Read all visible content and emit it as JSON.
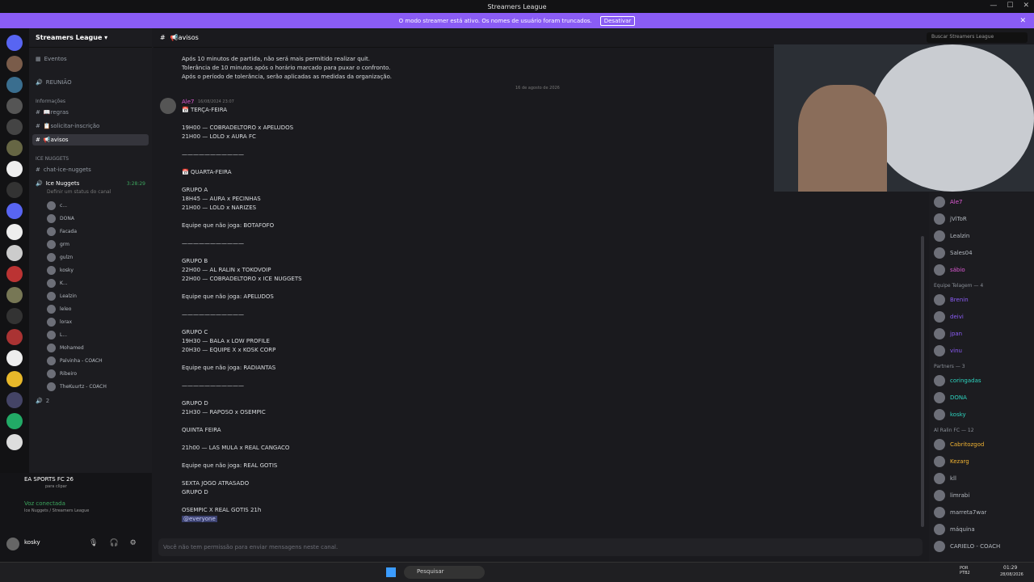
{
  "window": {
    "title": "Streamers League"
  },
  "banner": {
    "text": "O modo streamer está ativo. Os nomes de usuário foram truncados.",
    "button": "Desativar"
  },
  "server": {
    "name": "Streamers League"
  },
  "sidebar": {
    "events": "Eventos",
    "meeting": "REUNIÃO",
    "category_info": "Informações",
    "channels": [
      {
        "name": "📖regras"
      },
      {
        "name": "📋solicitar-inscrição"
      },
      {
        "name": "📢avisos"
      }
    ],
    "category_ice": "ICE NUGGETS",
    "chat_channel": "chat-ice-nuggets",
    "voice": {
      "name": "Ice Nuggets",
      "timer": "3:28:29",
      "status": "Definir um status do canal"
    },
    "voice_users": [
      "c...",
      "DONA",
      "Facada",
      "grm",
      "gulzn",
      "kosky",
      "K...",
      "Lealzin",
      "leleo",
      "lorax",
      "L...",
      "Mohamed",
      "Palvinha - COACH",
      "Ribeiro",
      "TheKuurtz - COACH"
    ],
    "more": "2"
  },
  "activity": {
    "game": "EA SPORTS FC 26",
    "hint": "para clipar",
    "voice_label": "Voz conectada",
    "voice_path": "Ice Nuggets / Streamers League"
  },
  "user": {
    "name": "kosky",
    "status": "..."
  },
  "channel": {
    "name": "📢avisos"
  },
  "search": {
    "placeholder": "Buscar Streamers League"
  },
  "messages": {
    "top_lines": [
      "Após 10 minutos de partida, não será mais permitido realizar quit.",
      "Tolerância de 10 minutos após o horário marcado para puxar o confronto.",
      "Após o período de tolerância, serão aplicadas as medidas da organização."
    ],
    "date_divider": "16 de agosto de 2026",
    "author": "Ale7",
    "timestamp": "16/08/2024 23:07",
    "lines": [
      "📅 TERÇA-FEIRA",
      "",
      "19H00 — COBRADELTORO x APELUDOS",
      "21H00 — LOLO x AURA FC",
      "",
      "———————————",
      "",
      "📅 QUARTA-FEIRA",
      "",
      "GRUPO A",
      "18H45 — AURA x PECINHAS",
      "21H00 — LOLO x NARIZES",
      "",
      "Equipe que não joga: BOTAFOFO",
      "",
      "———————————",
      "",
      "GRUPO B",
      "22H00 — AL RALIN x TOKOVOIP",
      "22H00 — COBRADELTORO x ICE NUGGETS",
      "",
      "Equipe que não joga: APELUDOS",
      "",
      "———————————",
      "",
      "GRUPO C",
      "19H30 — BALA x LOW PROFILE",
      "20H30 — EQUIPE X x KOSK CORP",
      "",
      "Equipe que não joga: RADIANTAS",
      "",
      "———————————",
      "",
      "GRUPO D",
      "21H30 — RAPOSO x OSEMPIC",
      "",
      "QUINTA FEIRA",
      "",
      "21h00 — LAS MULA x REAL CANGACO",
      "",
      "Equipe que não joga: REAL GOTIS",
      "",
      "SEXTA JOGO ATRASADO",
      "GRUPO D",
      "",
      "OSEMPIC X REAL GOTIS 21h",
      "@everyone"
    ],
    "composer": "Você não tem permissão para enviar mensagens neste canal."
  },
  "members": {
    "top": [
      "Ale7",
      "jViToR",
      "Lealzin",
      "Sales04",
      "sábio"
    ],
    "group1": "Equipe Telagem — 4",
    "group1_members": [
      "Brenin",
      "deivi",
      "jpan",
      "vinu"
    ],
    "group2": "Partners — 3",
    "group2_members": [
      "coringadas",
      "DONA",
      "kosky"
    ],
    "group3": "Al Ralin FC — 12",
    "group3_members": [
      "Cabritozgod",
      "Kezarg",
      "kll",
      "limrabi",
      "marreta7war",
      "máquina",
      "CARIELO - COACH"
    ]
  },
  "taskbar": {
    "search": "Pesquisar",
    "time": "01:29",
    "date": "28/08/2026",
    "lang": "POR PTB2"
  }
}
